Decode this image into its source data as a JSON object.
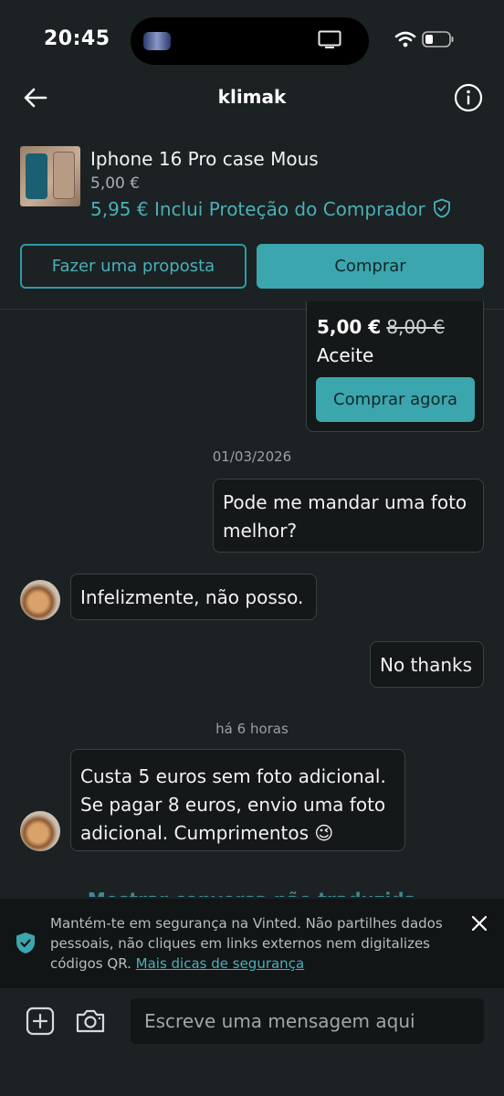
{
  "status_bar": {
    "time": "20:45"
  },
  "header": {
    "title": "klimak"
  },
  "product": {
    "name": "Iphone 16 Pro case Mous",
    "price": "5,00 €",
    "total_price": "5,95 €",
    "protection_text": "Inclui Proteção do Comprador"
  },
  "actions": {
    "offer_label": "Fazer uma proposta",
    "buy_label": "Comprar"
  },
  "offer_card": {
    "amount": "5,00 €",
    "original_amount": "8,00 €",
    "status": "Aceite",
    "buy_now_label": "Comprar agora"
  },
  "messages": [
    {
      "date": "01/03/2026"
    },
    {
      "from": "me",
      "text": "Pode me mandar uma foto\nmelhor?"
    },
    {
      "from": "seller",
      "text": "Infelizmente, não posso."
    },
    {
      "from": "me",
      "text": "No thanks"
    },
    {
      "date": "há 6 horas"
    },
    {
      "from": "seller",
      "text": "Custa 5 euros sem foto adicional.\nSe pagar 8 euros, envio uma foto\nadicional. Cumprimentos 😉"
    }
  ],
  "translate_link": "Mostrar conversa não traduzida",
  "safety_banner": {
    "text": "Mantém-te em segurança na Vinted. Não partilhes dados pessoais, não cliques em links externos nem digitalizes códigos QR.",
    "link": "Mais dicas de segurança"
  },
  "composer": {
    "placeholder": "Escreve uma mensagem aqui"
  },
  "colors": {
    "accent": "#3ca6ae",
    "background": "#1c2123",
    "bubble": "#141819"
  },
  "icons": [
    "back-arrow-icon",
    "info-icon",
    "shield-check-icon",
    "close-icon",
    "add-icon",
    "camera-icon",
    "wifi-icon",
    "battery-icon"
  ]
}
